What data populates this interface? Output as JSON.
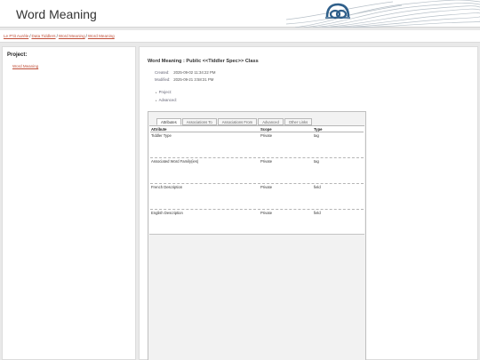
{
  "header": {
    "title": "Word Meaning",
    "logo_icon": "site-logo",
    "brand_color": "#2f5f8a"
  },
  "breadcrumb": [
    "Le P'tit Aurèle",
    "Data Tiddlers",
    "Word Meaning",
    "Word Meaning"
  ],
  "breadcrumb_separator": "/",
  "sidebar": {
    "title": "Project:",
    "items": [
      "Word Meaning"
    ]
  },
  "main": {
    "title": "Word Meaning : Public <<Tiddler Spec>> Class",
    "created_label": "Created:",
    "created_value": "2025-09-02 11:34:22 PM",
    "modified_label": "Modified:",
    "modified_value": "2025-09-21 3:58:31 PM",
    "toggles": [
      "Project:",
      "Advanced:"
    ]
  },
  "tabs": [
    "Attributes",
    "Associations To",
    "Associations From",
    "Advanced",
    "Other Links"
  ],
  "active_tab": "Attributes",
  "attributes_table": {
    "headers": [
      "Attribute",
      "Scope",
      "Type"
    ],
    "rows": [
      [
        "Tiddler Type",
        "Private",
        "tag"
      ],
      [
        "Associated Word Family(ies)",
        "Private",
        "tag"
      ],
      [
        "French Description",
        "Private",
        "field"
      ],
      [
        "English Description",
        "Private",
        "field"
      ]
    ]
  },
  "colors": {
    "link": "#c0503a",
    "panel_background": "#f2f2f2",
    "page_background": "#e9e9e9"
  }
}
